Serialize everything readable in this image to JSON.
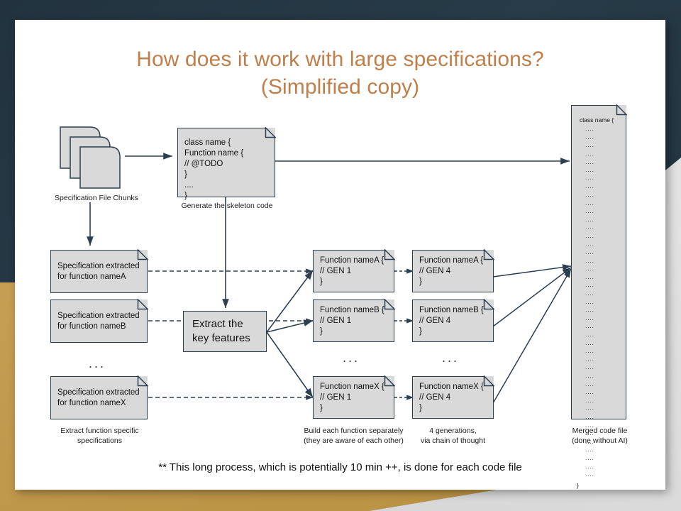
{
  "slide": {
    "title_line1": "How does it work with large specifications?",
    "title_line2": "(Simplified copy)",
    "title_color": "#bf7f4a",
    "footnote": "** This long process, which is potentially 10 min ++, is done for each code file"
  },
  "theme": {
    "navy": "#253845",
    "gold": "#c29a4f",
    "gray": "#dcdcdc",
    "node_fill": "#d9d9d9",
    "node_stroke": "#2c3e50"
  },
  "nodes": {
    "chunks_caption": "Specification File Chunks",
    "skeleton": {
      "code": "class name {\n    Function name {\n       // @TODO\n    }\n    ....\n}",
      "caption": "Generate the skeleton code"
    },
    "specs": [
      {
        "text": "Specification extracted\nfor function nameA"
      },
      {
        "text": "Specification extracted\nfor function nameB"
      },
      {
        "text": "Specification extracted\nfor function nameX"
      }
    ],
    "specs_caption": "Extract function specific\nspecifications",
    "specs_ellipsis": "...",
    "extract": {
      "label": "Extract the\nkey features"
    },
    "gen1": [
      {
        "text": "Function nameA {\n   // GEN 1\n}"
      },
      {
        "text": "Function nameB {\n   // GEN 1\n}"
      },
      {
        "text": "Function nameX {\n   // GEN 1\n}"
      }
    ],
    "gen1_caption": "Build each function separately\n(they are aware of each other)",
    "gen1_ellipsis": "...",
    "gen4": [
      {
        "text": "Function nameA {\n   // GEN 4\n}"
      },
      {
        "text": "Function nameB {\n   // GEN 4\n}"
      },
      {
        "text": "Function nameX {\n   // GEN 4\n}"
      }
    ],
    "gen4_caption": "4 generations,\nvia chain of thought",
    "gen4_ellipsis": "...",
    "merged": {
      "header": "class name {",
      "line": "....",
      "line_count": 43,
      "footer": "}",
      "caption": "Merged code file\n(done without AI)"
    }
  }
}
